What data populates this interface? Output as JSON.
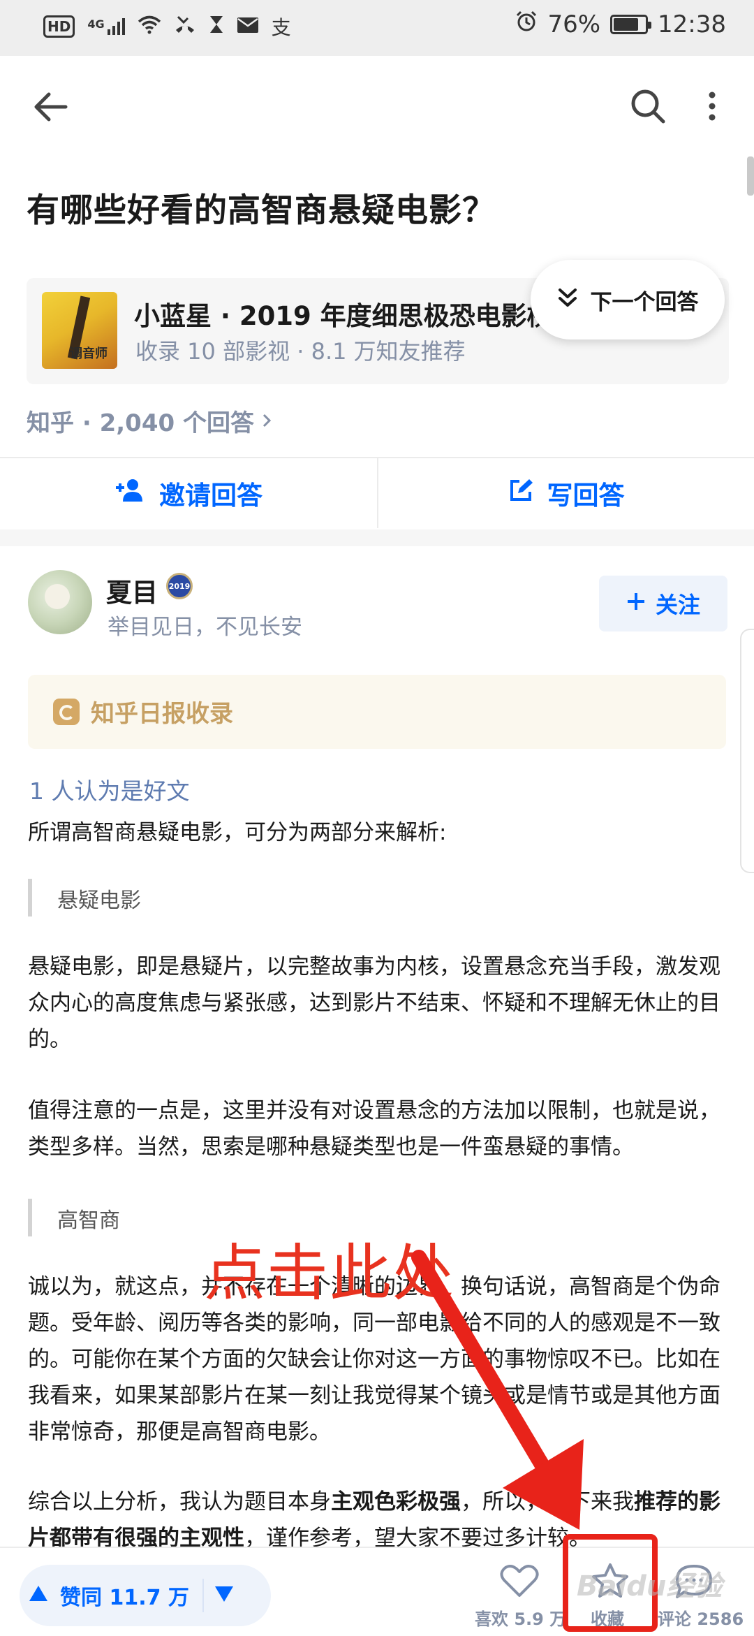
{
  "status_bar": {
    "left_icons": [
      "hd-badge",
      "signal-4g-icon",
      "wifi-icon",
      "missed-call-icon",
      "hourglass-icon",
      "mail-icon",
      "alipay-icon"
    ],
    "hd": "HD",
    "network": "4G",
    "alipay": "支",
    "battery": "76%",
    "battery_level": 0.76,
    "time": "12:38"
  },
  "question": {
    "title": "有哪些好看的高智商悬疑电影？"
  },
  "collection": {
    "title": "小蓝星 · 2019 年度细思极恐电影榜",
    "subtitle": "收录 10 部影视 · 8.1 万知友推荐",
    "poster_text": "调音师"
  },
  "next_answer": {
    "label": "下一个回答"
  },
  "meta": {
    "text": "知乎 · 2,040 个回答"
  },
  "actions": {
    "invite": "邀请回答",
    "write": "写回答"
  },
  "author": {
    "name": "夏目",
    "badge": "2019",
    "bio": "举目见日，不见长安",
    "follow": "关注"
  },
  "daily": {
    "label": "知乎日报收录"
  },
  "article": {
    "likes": "1 人认为是好文",
    "p1": "所谓高智商悬疑电影，可分为两部分来解析:",
    "q1": "悬疑电影",
    "p2": "悬疑电影，即是悬疑片，以完整故事为内核，设置悬念充当手段，激发观众内心的高度焦虑与紧张感，达到影片不结束、怀疑和不理解无休止的目的。",
    "p3": "值得注意的一点是，这里并没有对设置悬念的方法加以限制，也就是说，类型多样。当然，思索是哪种悬疑类型也是一件蛮悬疑的事情。",
    "q2": "高智商",
    "p4": "诚以为，就这点，并不存在一个清晰的边界。换句话说，高智商是个伪命题。受年龄、阅历等各类的影响，同一部电影给不同的人的感观是不一致的。可能你在某个方面的欠缺会让你对这一方面的事物惊叹不已。比如在我看来，如果某部影片在某一刻让我觉得某个镜头或是情节或是其他方面非常惊奇，那便是高智商电影。",
    "p5_a": "综合以上分析，我认为题目本身",
    "p5_b": "主观色彩极强",
    "p5_c": "，所以，接下来我",
    "p5_d": "推荐的影片都带有很强的主观性",
    "p5_e": "，谨作参考，望大家不要过多计较。"
  },
  "annotation": {
    "text": "点击此处",
    "color": "#e8321f"
  },
  "bottom_bar": {
    "upvote": "赞同 11.7 万",
    "like": "喜欢 5.9 万",
    "collect": "收藏",
    "comment": "评论 2586"
  },
  "watermark": "Baidu经验",
  "colors": {
    "accent": "#0066ff",
    "meta_gray": "#8590a6",
    "highlight": "#e8231a",
    "daily_gold": "#c6a063"
  }
}
